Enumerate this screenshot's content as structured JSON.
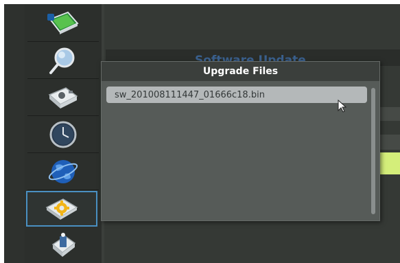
{
  "sidebar": {
    "items": [
      {
        "icon": "screen-icon"
      },
      {
        "icon": "magnifier-icon"
      },
      {
        "icon": "camera-icon"
      },
      {
        "icon": "clock-icon"
      },
      {
        "icon": "globe-icon"
      },
      {
        "icon": "gear-settings-icon",
        "selected": true
      },
      {
        "icon": "document-icon"
      }
    ]
  },
  "background": {
    "title": "Software Update"
  },
  "dialog": {
    "title": "Upgrade Files",
    "files": [
      "sw_201008111447_01666c18.bin"
    ]
  },
  "colors": {
    "highlight_row": "#d4ee7a",
    "selection_border": "#4a90c2",
    "title_blue": "#3d6aa0"
  }
}
